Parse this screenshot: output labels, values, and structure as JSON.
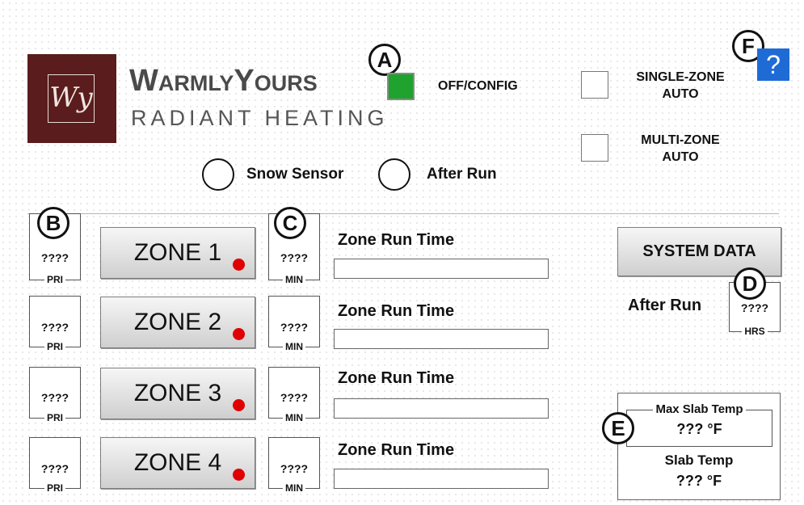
{
  "brand": {
    "monogram": "Wy",
    "name": "WarmlyYours",
    "tagline": "RADIANT HEATING"
  },
  "callouts": {
    "a": "A",
    "b": "B",
    "c": "C",
    "d": "D",
    "e": "E",
    "f": "F"
  },
  "modes": {
    "off_config": {
      "label": "OFF/CONFIG",
      "active": true,
      "color": "#1fa22e"
    },
    "single_zone": {
      "line1": "SINGLE-ZONE",
      "line2": "AUTO",
      "active": false
    },
    "multi_zone": {
      "line1": "MULTI-ZONE",
      "line2": "AUTO",
      "active": false
    }
  },
  "help": {
    "label": "?",
    "icon": "question-icon",
    "color": "#1f6bd6"
  },
  "options": {
    "snow_sensor": "Snow Sensor",
    "after_run": "After Run"
  },
  "zones": [
    {
      "label": "ZONE 1",
      "priority": "????",
      "priority_unit": "PRI",
      "minutes": "????",
      "minutes_unit": "MIN",
      "run_time_label": "Zone Run Time",
      "status_color": "#e00000"
    },
    {
      "label": "ZONE 2",
      "priority": "????",
      "priority_unit": "PRI",
      "minutes": "????",
      "minutes_unit": "MIN",
      "run_time_label": "Zone Run Time",
      "status_color": "#e00000"
    },
    {
      "label": "ZONE 3",
      "priority": "????",
      "priority_unit": "PRI",
      "minutes": "????",
      "minutes_unit": "MIN",
      "run_time_label": "Zone Run Time",
      "status_color": "#e00000"
    },
    {
      "label": "ZONE 4",
      "priority": "????",
      "priority_unit": "PRI",
      "minutes": "????",
      "minutes_unit": "MIN",
      "run_time_label": "Zone Run Time",
      "status_color": "#e00000"
    }
  ],
  "system": {
    "button": "SYSTEM DATA",
    "after_run_label": "After Run",
    "after_run_value": "????",
    "after_run_unit": "HRS",
    "max_slab_label": "Max Slab Temp",
    "max_slab_value": "??? °F",
    "slab_label": "Slab Temp",
    "slab_value": "??? °F"
  }
}
